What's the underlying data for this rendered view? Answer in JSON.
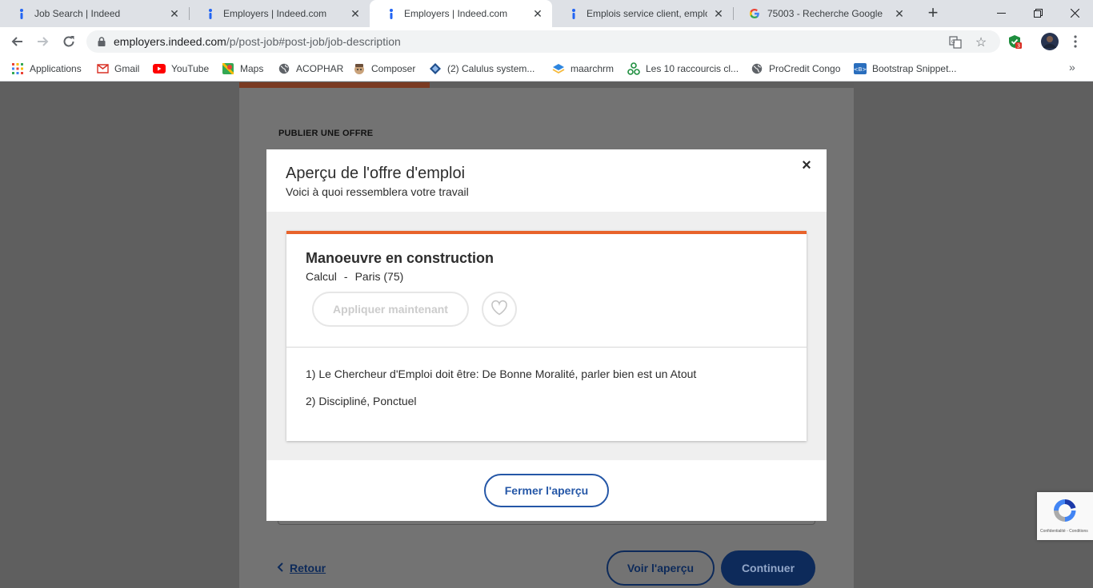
{
  "browser": {
    "tabs": [
      {
        "label": "Job Search | Indeed",
        "icon": "indeed-icon"
      },
      {
        "label": "Employers | Indeed.com",
        "icon": "indeed-icon"
      },
      {
        "label": "Employers | Indeed.com",
        "icon": "indeed-icon",
        "active": true
      },
      {
        "label": "Emplois service client, emploi |",
        "icon": "indeed-icon"
      },
      {
        "label": "75003 - Recherche Google",
        "icon": "google-icon"
      }
    ],
    "url_host": "employers.indeed.com",
    "url_path": "/p/post-job#post-job/job-description",
    "extension_badge": "3",
    "bookmarks": [
      {
        "label": "Applications",
        "icon": "apps-grid-icon"
      },
      {
        "label": "Gmail",
        "icon": "gmail-icon"
      },
      {
        "label": "YouTube",
        "icon": "youtube-icon"
      },
      {
        "label": "Maps",
        "icon": "maps-icon"
      },
      {
        "label": "ACOPHAR",
        "icon": "globe-icon"
      },
      {
        "label": "Composer",
        "icon": "composer-icon"
      },
      {
        "label": "(2) Calulus system...",
        "icon": "calulus-icon"
      },
      {
        "label": "maarchrm",
        "icon": "maarch-icon"
      },
      {
        "label": "Les 10 raccourcis cl...",
        "icon": "network-icon"
      },
      {
        "label": "ProCredit Congo",
        "icon": "globe-icon"
      },
      {
        "label": "Bootstrap Snippet...",
        "icon": "bootstrap-icon"
      }
    ],
    "more_bookmarks": "»"
  },
  "page": {
    "kicker": "PUBLIER UNE OFFRE",
    "progress_fraction": 0.31,
    "back_label": "Retour",
    "preview_label": "Voir l'aperçu",
    "continue_label": "Continuer"
  },
  "modal": {
    "title": "Aperçu de l'offre d'emploi",
    "subtitle": "Voici à quoi ressemblera votre travail",
    "close_glyph": "×",
    "job": {
      "title": "Manoeuvre en construction",
      "company": "Calcul",
      "separator": "-",
      "location": "Paris (75)",
      "apply_label": "Appliquer maintenant",
      "description": [
        "1) Le Chercheur d'Emploi doit être: De Bonne Moralité, parler bien est un Atout",
        "2) Discipliné, Ponctuel"
      ]
    },
    "close_preview_label": "Fermer l'aperçu"
  },
  "recaptcha": {
    "links": [
      "Confidentialité",
      "Conditions"
    ]
  },
  "colors": {
    "indeed_orange": "#e8632b",
    "indeed_blue": "#2557a7",
    "navy": "#0d2a5a"
  }
}
